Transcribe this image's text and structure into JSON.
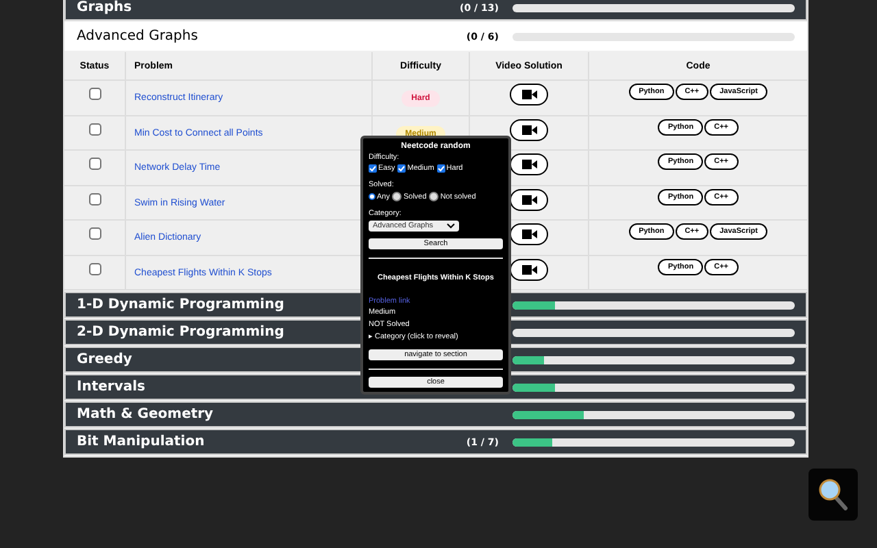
{
  "sections_before": [
    {
      "name": "Graphs",
      "count": "(0 / 13)"
    }
  ],
  "open_section": {
    "name": "Advanced Graphs",
    "count": "(0 / 6)",
    "columns": [
      "Status",
      "Problem",
      "Difficulty",
      "Video Solution",
      "Code"
    ],
    "rows": [
      {
        "checked": false,
        "problem": "Reconstruct Itinerary",
        "difficulty": "Hard",
        "code": [
          "Python",
          "C++",
          "JavaScript"
        ]
      },
      {
        "checked": false,
        "problem": "Min Cost to Connect all Points",
        "difficulty": "Medium",
        "code": [
          "Python",
          "C++"
        ]
      },
      {
        "checked": false,
        "problem": "Network Delay Time",
        "code": [
          "Python",
          "C++"
        ]
      },
      {
        "checked": false,
        "problem": "Swim in Rising Water",
        "code": [
          "Python",
          "C++"
        ]
      },
      {
        "checked": false,
        "problem": "Alien Dictionary",
        "code": [
          "Python",
          "C++",
          "JavaScript"
        ]
      },
      {
        "checked": false,
        "problem": "Cheapest Flights Within K Stops",
        "code": [
          "Python",
          "C++"
        ]
      }
    ]
  },
  "sections_after": [
    {
      "name": "1-D Dynamic Programming",
      "level": 0.15
    },
    {
      "name": "2-D Dynamic Programming"
    },
    {
      "name": "Greedy",
      "level": 0.11
    },
    {
      "name": "Intervals",
      "level": 0.15
    },
    {
      "name": "Math & Geometry",
      "level": 0.25
    },
    {
      "name": "Bit Manipulation",
      "count": "(1 / 7)",
      "level": 0.14
    }
  ],
  "popup": {
    "title": "Neetcode random",
    "difficulty_label": "Difficulty:",
    "difficulties": [
      {
        "label": "Easy",
        "checked": true
      },
      {
        "label": "Medium",
        "checked": true
      },
      {
        "label": "Hard",
        "checked": true
      }
    ],
    "solved_label": "Solved:",
    "solved_options": [
      {
        "label": "Any",
        "selected": true
      },
      {
        "label": "Solved",
        "selected": false
      },
      {
        "label": "Not solved",
        "selected": false
      }
    ],
    "category_label": "Category:",
    "category_value": "Advanced Graphs",
    "search_button": "Search",
    "result_title": "Cheapest Flights Within K Stops",
    "problem_link": "Problem link",
    "result_difficulty": "Medium",
    "result_status": "NOT Solved",
    "category_toggle": "▸ Category (click to reveal)",
    "navigate_button": "navigate to section",
    "close_button": "close"
  }
}
